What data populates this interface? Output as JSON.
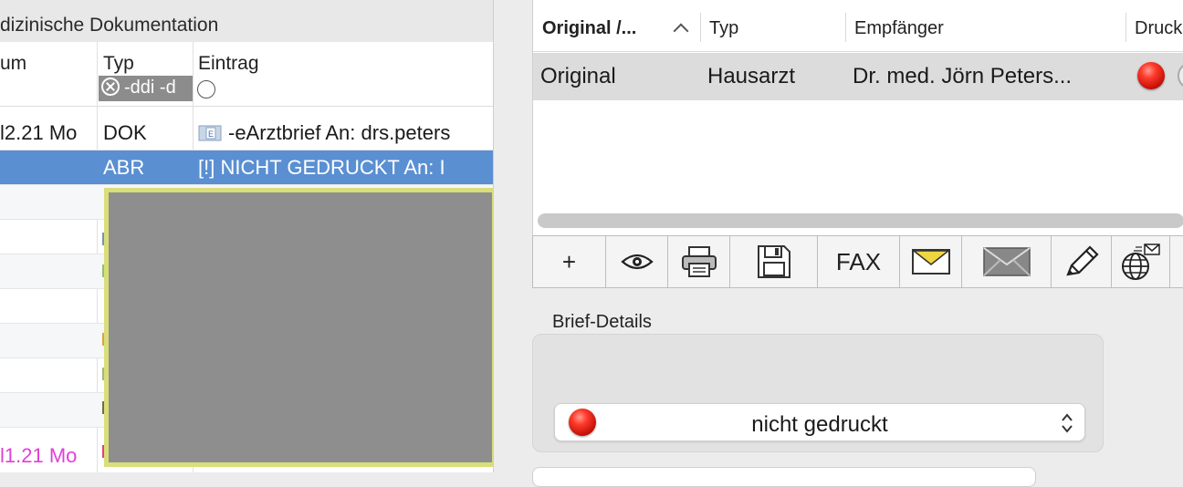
{
  "left": {
    "title": "dizinische Dokumentation",
    "columns": {
      "datum": "um",
      "typ": "Typ",
      "eintrag": "Eintrag"
    },
    "filter_text": "-ddi -d",
    "rows": [
      {
        "date": "l2.21  Mo",
        "typ": "DOK",
        "eintrag": "-eArztbrief   An: drs.peters"
      },
      {
        "date": "",
        "typ": "ABR",
        "eintrag": "[!] NICHT GEDRUCKT An:  I"
      },
      {
        "date": "l1.21  Mo",
        "typ": ""
      }
    ]
  },
  "right": {
    "table_headers": {
      "original": "Original /...",
      "typ": "Typ",
      "empfaenger": "Empfänger",
      "druck": "Druck"
    },
    "row": {
      "original": "Original",
      "typ": "Hausarzt",
      "empfaenger": "Dr. med. Jörn Peters..."
    },
    "toolbar": {
      "add_label": "+",
      "fax_label": "FAX"
    },
    "details_label": "Brief-Details",
    "status_value": "nicht gedruckt"
  },
  "colors": {
    "selection": "#5a8fd2",
    "status_red": "#e02418",
    "highlight_border": "#d9de7a",
    "pink_text": "#e040d8"
  },
  "icons": [
    "clear-filter-icon",
    "radio-icon",
    "e-letter-icon",
    "red-status-icon",
    "sort-chevron-icon",
    "eye-icon",
    "printer-icon",
    "floppy-disk-icon",
    "envelope-yellow-icon",
    "envelope-gray-icon",
    "pencil-icon",
    "globe-mail-icon",
    "stepper-icon"
  ]
}
